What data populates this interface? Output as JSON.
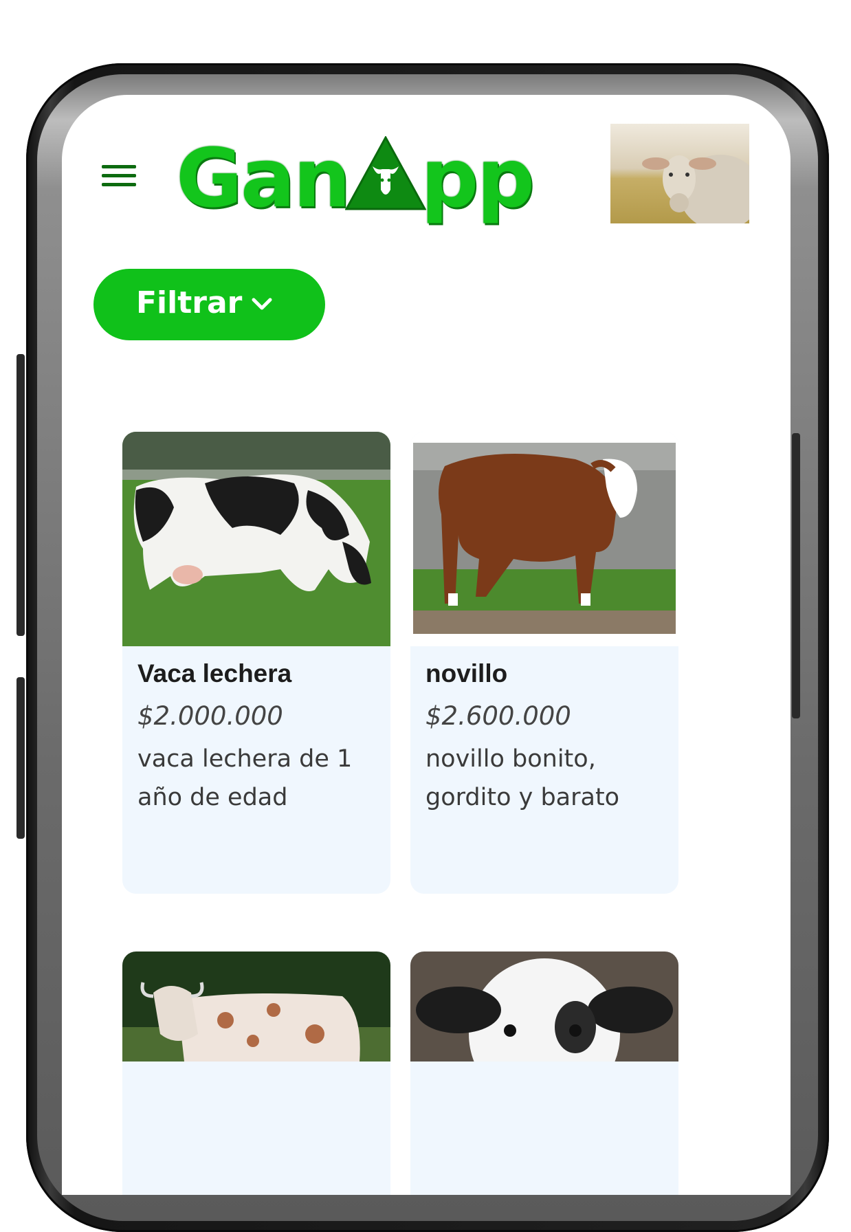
{
  "app": {
    "logo_text_left": "Gan",
    "logo_text_right": "pp"
  },
  "header": {
    "menu_icon": "hamburger-menu-icon",
    "profile_image": "profile-cow-photo"
  },
  "filter": {
    "label": "Filtrar",
    "icon": "chevron-down-icon"
  },
  "listings": [
    {
      "title": "Vaca lechera",
      "price": "$2.000.000",
      "description": "vaca lechera de 1 año de edad",
      "image": "holstein-cow-photo"
    },
    {
      "title": "novillo",
      "price": "$2.600.000",
      "description": "novillo bonito, gordito y barato",
      "image": "brown-steer-photo"
    },
    {
      "title": "",
      "price": "",
      "description": "",
      "image": "spotted-zebu-cow-photo"
    },
    {
      "title": "",
      "price": "",
      "description": "",
      "image": "black-white-calf-photo"
    }
  ],
  "colors": {
    "brand_green": "#10c11a",
    "dark_green": "#0d6b10",
    "card_bg": "#f0f7fe"
  }
}
